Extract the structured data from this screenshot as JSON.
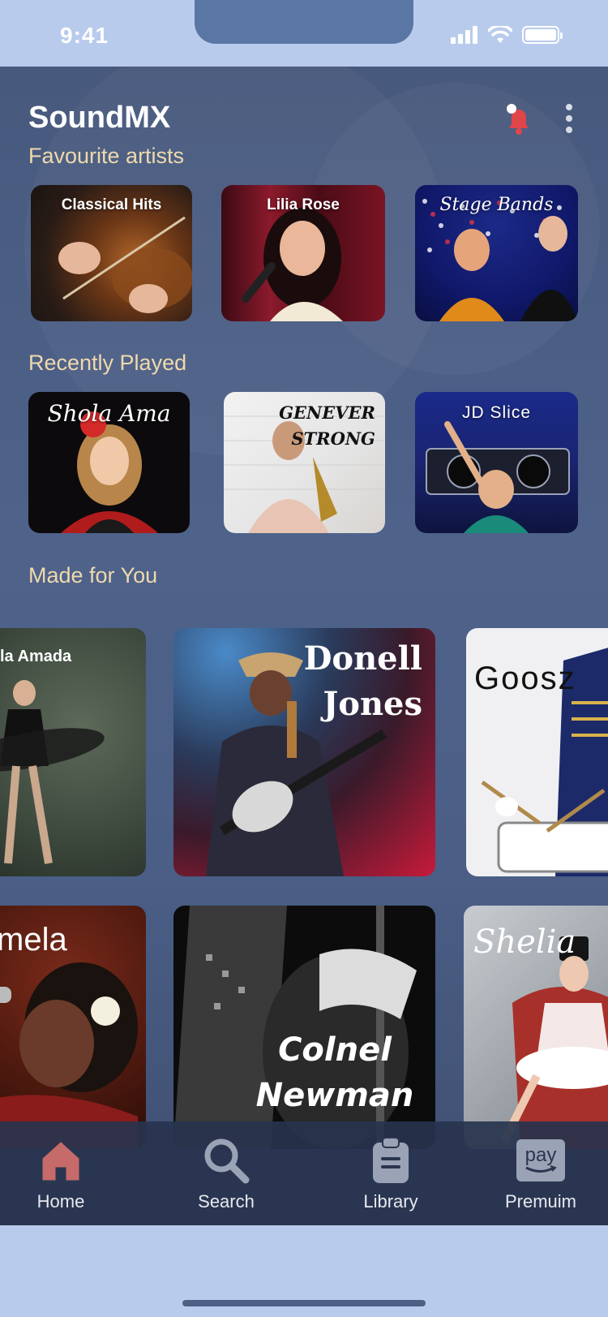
{
  "status_bar": {
    "time": "9:41"
  },
  "app": {
    "title": "SoundMX"
  },
  "sections": {
    "favourite": "Favourite  artists",
    "recent": "Recently Played",
    "made": "Made for You"
  },
  "favourite_artists": [
    {
      "label": "Classical Hits"
    },
    {
      "label": "Lilia Rose"
    },
    {
      "label": "Stage Bands"
    }
  ],
  "recently_played": [
    {
      "label": "Shola Ama"
    },
    {
      "label": "GENEVER STRONG"
    },
    {
      "label": "JD Slice"
    }
  ],
  "made_for_you": [
    {
      "label": "la Amada"
    },
    {
      "label": "Donell Jones"
    },
    {
      "label": "Goosz"
    },
    {
      "label": "mela"
    },
    {
      "label": "Colnel Newman"
    },
    {
      "label": "Shelia"
    }
  ],
  "tabs": {
    "home": "Home",
    "search": "Search",
    "library": "Library",
    "premium": "Premuim",
    "pay": "pay"
  },
  "colors": {
    "accent": "#efd9ad",
    "home_active": "#c76a6a",
    "bell": "#e0454a"
  }
}
